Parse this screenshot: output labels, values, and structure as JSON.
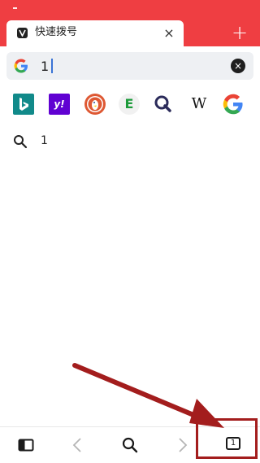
{
  "tab": {
    "title": "快速拨号",
    "close_label": "×"
  },
  "new_tab_label": "+",
  "search": {
    "value": "1",
    "clear_label": "×"
  },
  "engines": [
    {
      "name": "bing"
    },
    {
      "name": "yahoo",
      "label": "y!"
    },
    {
      "name": "duckduckgo"
    },
    {
      "name": "ecosia",
      "label": "E"
    },
    {
      "name": "qwant"
    },
    {
      "name": "wikipedia",
      "label": "W"
    },
    {
      "name": "google"
    }
  ],
  "suggestions": [
    {
      "text": "1"
    }
  ],
  "toolbar": {
    "tab_count": "1"
  },
  "colors": {
    "brand_red": "#ef3e42",
    "annotation_red": "#a31d1d"
  }
}
